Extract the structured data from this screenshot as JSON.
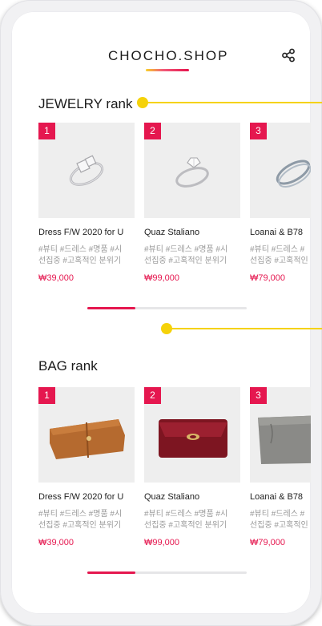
{
  "brand": {
    "name": "CHOCHO.SHOP"
  },
  "icons": {
    "share": "share-icon"
  },
  "colors": {
    "accent": "#e5174f",
    "highlight": "#f5d20a",
    "thumb_bg": "#eeeeee"
  },
  "sections": [
    {
      "title": "JEWELRY rank",
      "pager_progress": 0.3,
      "products": [
        {
          "rank": "1",
          "name": "Dress F/W 2020 for U",
          "tags_line1": "#뷰티 #드레스 #명품 #시",
          "tags_line2": "선집중 #고혹적인 분위기",
          "price": "₩39,000"
        },
        {
          "rank": "2",
          "name": "Quaz Staliano",
          "tags_line1": "#뷰티 #드레스 #명품 #시",
          "tags_line2": "선집중 #고혹적인 분위기",
          "price": "₩99,000"
        },
        {
          "rank": "3",
          "name": "Loanai & B78",
          "tags_line1": "#뷰티 #드레스 #",
          "tags_line2": "선집중 #고혹적인",
          "price": "₩79,000"
        }
      ]
    },
    {
      "title": "BAG rank",
      "pager_progress": 0.3,
      "products": [
        {
          "rank": "1",
          "name": "Dress F/W 2020 for U",
          "tags_line1": "#뷰티 #드레스 #명품 #시",
          "tags_line2": "선집중 #고혹적인 분위기",
          "price": "₩39,000"
        },
        {
          "rank": "2",
          "name": "Quaz Staliano",
          "tags_line1": "#뷰티 #드레스 #명품 #시",
          "tags_line2": "선집중 #고혹적인 분위기",
          "price": "₩99,000"
        },
        {
          "rank": "3",
          "name": "Loanai & B78",
          "tags_line1": "#뷰티 #드레스 #",
          "tags_line2": "선집중 #고혹적인",
          "price": "₩79,000"
        }
      ]
    }
  ]
}
